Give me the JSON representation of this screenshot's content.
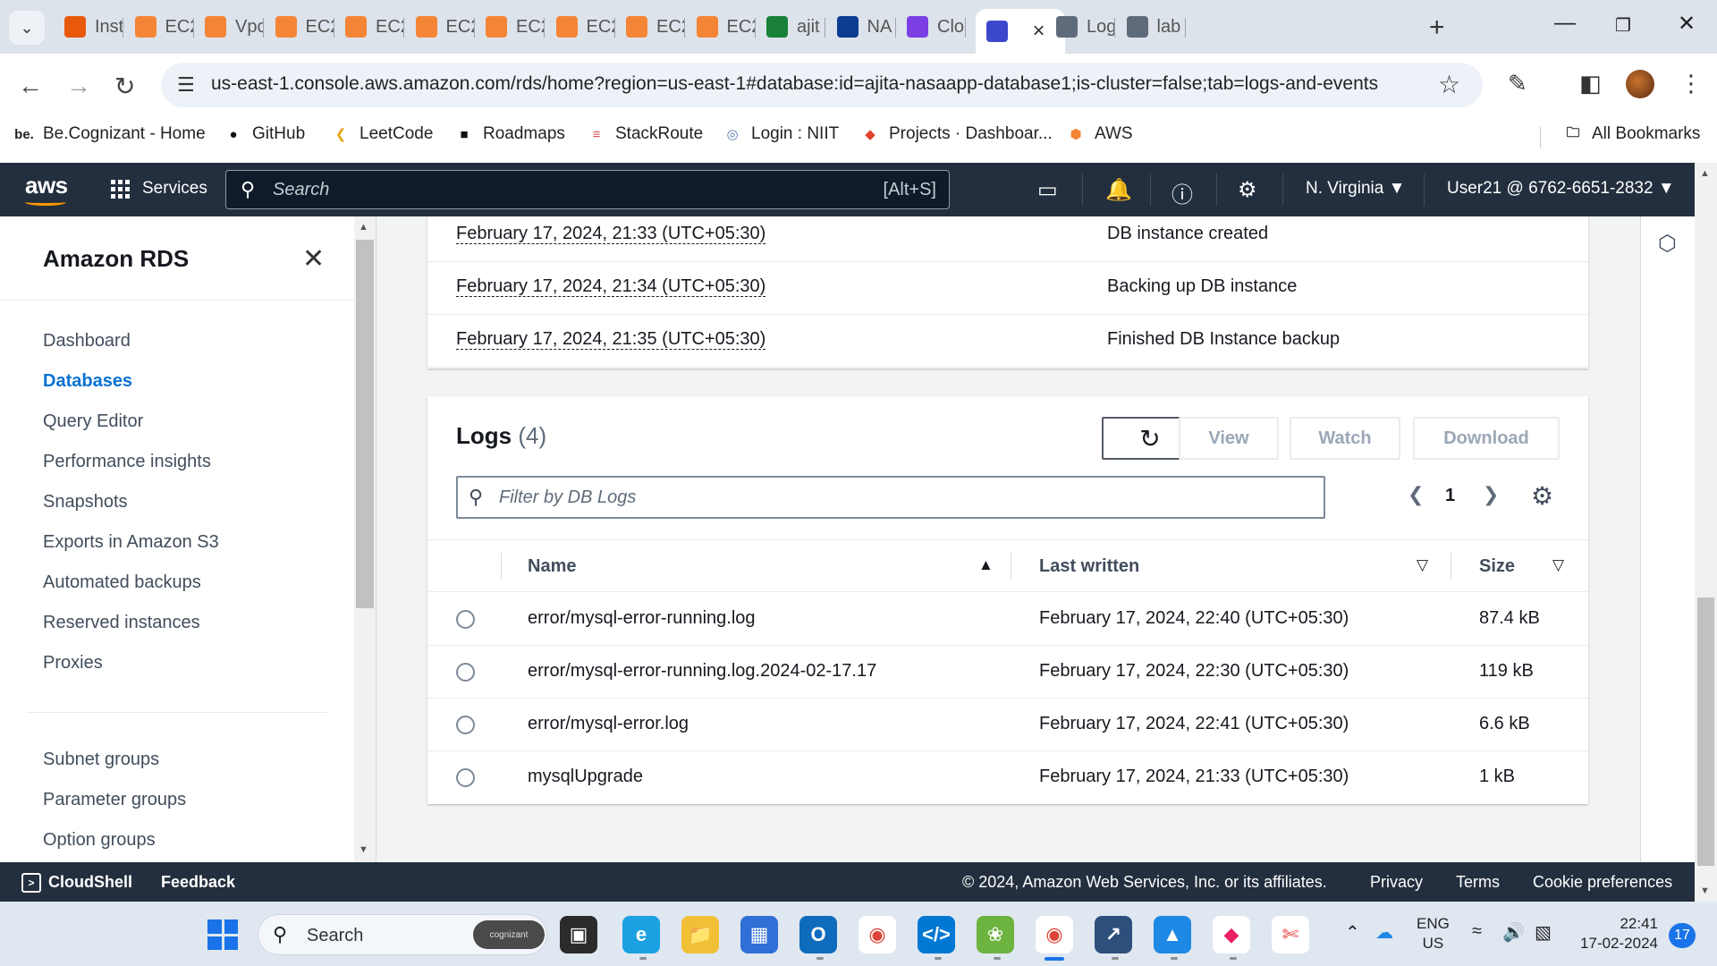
{
  "browser": {
    "tabs": [
      {
        "label": "Inst",
        "icon": "aws-icon",
        "color": "#e8590c"
      },
      {
        "label": "EC2",
        "icon": "aws-ec2-icon",
        "color": "#f58536"
      },
      {
        "label": "Vpc",
        "icon": "aws-vpc-icon",
        "color": "#f58536"
      },
      {
        "label": "EC2",
        "icon": "aws-ec2-icon",
        "color": "#f58536"
      },
      {
        "label": "EC2",
        "icon": "aws-ec2-icon",
        "color": "#f58536"
      },
      {
        "label": "EC2",
        "icon": "aws-ec2-icon",
        "color": "#f58536"
      },
      {
        "label": "EC2",
        "icon": "aws-ec2-icon",
        "color": "#f58536"
      },
      {
        "label": "EC2",
        "icon": "aws-ec2-icon",
        "color": "#f58536"
      },
      {
        "label": "EC2",
        "icon": "aws-ec2-icon",
        "color": "#f58536"
      },
      {
        "label": "EC2",
        "icon": "aws-ec2-icon",
        "color": "#f58536"
      },
      {
        "label": "ajit",
        "icon": "green-doc-icon",
        "color": "#188038"
      },
      {
        "label": "NA",
        "icon": "nasa-icon",
        "color": "#0b3d91"
      },
      {
        "label": "Clo",
        "icon": "purple-icon",
        "color": "#7b3fe4"
      },
      {
        "label": "",
        "icon": "rds-icon",
        "color": "#3b48cc",
        "active": true
      },
      {
        "label": "Log",
        "icon": "globe-icon",
        "color": "#5f6b7a"
      },
      {
        "label": "lab",
        "icon": "globe-icon",
        "color": "#5f6b7a"
      }
    ],
    "url": "us-east-1.console.aws.amazon.com/rds/home?region=us-east-1#database:id=ajita-nasaapp-database1;is-cluster=false;tab=logs-and-events",
    "bookmarks": [
      {
        "label": "Be.Cognizant - Home",
        "icon": "be"
      },
      {
        "label": "GitHub",
        "icon": "github-icon"
      },
      {
        "label": "LeetCode",
        "icon": "leetcode-icon"
      },
      {
        "label": "Roadmaps",
        "icon": "roadmaps-icon"
      },
      {
        "label": "StackRoute",
        "icon": "stackroute-icon"
      },
      {
        "label": "Login : NIIT",
        "icon": "globe-icon"
      },
      {
        "label": "Projects · Dashboar...",
        "icon": "gitlab-icon"
      },
      {
        "label": "AWS",
        "icon": "aws-icon"
      }
    ],
    "all_bookmarks": "All Bookmarks"
  },
  "aws": {
    "logo": "aws",
    "services": "Services",
    "search_placeholder": "Search",
    "search_shortcut": "[Alt+S]",
    "region": "N. Virginia ▼",
    "user": "User21 @ 6762-6651-2832 ▼"
  },
  "sidebar": {
    "title": "Amazon RDS",
    "items": [
      {
        "label": "Dashboard"
      },
      {
        "label": "Databases",
        "active": true
      },
      {
        "label": "Query Editor"
      },
      {
        "label": "Performance insights"
      },
      {
        "label": "Snapshots"
      },
      {
        "label": "Exports in Amazon S3"
      },
      {
        "label": "Automated backups"
      },
      {
        "label": "Reserved instances"
      },
      {
        "label": "Proxies"
      }
    ],
    "items2": [
      {
        "label": "Subnet groups"
      },
      {
        "label": "Parameter groups"
      },
      {
        "label": "Option groups"
      }
    ]
  },
  "events": [
    {
      "time": "February 17, 2024, 21:33 (UTC+05:30)",
      "message": "DB instance created"
    },
    {
      "time": "February 17, 2024, 21:34 (UTC+05:30)",
      "message": "Backing up DB instance"
    },
    {
      "time": "February 17, 2024, 21:35 (UTC+05:30)",
      "message": "Finished DB Instance backup"
    }
  ],
  "logs": {
    "title": "Logs",
    "count": "(4)",
    "buttons": {
      "view": "View",
      "watch": "Watch",
      "download": "Download"
    },
    "filter_placeholder": "Filter by DB Logs",
    "page": "1",
    "columns": {
      "name": "Name",
      "last_written": "Last written",
      "size": "Size"
    },
    "rows": [
      {
        "name": "error/mysql-error-running.log",
        "last_written": "February 17, 2024, 22:40 (UTC+05:30)",
        "size": "87.4 kB"
      },
      {
        "name": "error/mysql-error-running.log.2024-02-17.17",
        "last_written": "February 17, 2024, 22:30 (UTC+05:30)",
        "size": "119 kB"
      },
      {
        "name": "error/mysql-error.log",
        "last_written": "February 17, 2024, 22:41 (UTC+05:30)",
        "size": "6.6 kB"
      },
      {
        "name": "mysqlUpgrade",
        "last_written": "February 17, 2024, 21:33 (UTC+05:30)",
        "size": "1 kB"
      }
    ]
  },
  "footer": {
    "cloudshell": "CloudShell",
    "feedback": "Feedback",
    "copyright": "© 2024, Amazon Web Services, Inc. or its affiliates.",
    "privacy": "Privacy",
    "terms": "Terms",
    "cookie": "Cookie preferences"
  },
  "taskbar": {
    "search": "Search",
    "search_badge": "cognizant",
    "lang_line1": "ENG",
    "lang_line2": "US",
    "time": "22:41",
    "date": "17-02-2024",
    "notifications": "17"
  },
  "colors": {
    "aws_nav": "#232f3e",
    "aws_orange": "#ff9900",
    "link_blue": "#0972d3"
  }
}
